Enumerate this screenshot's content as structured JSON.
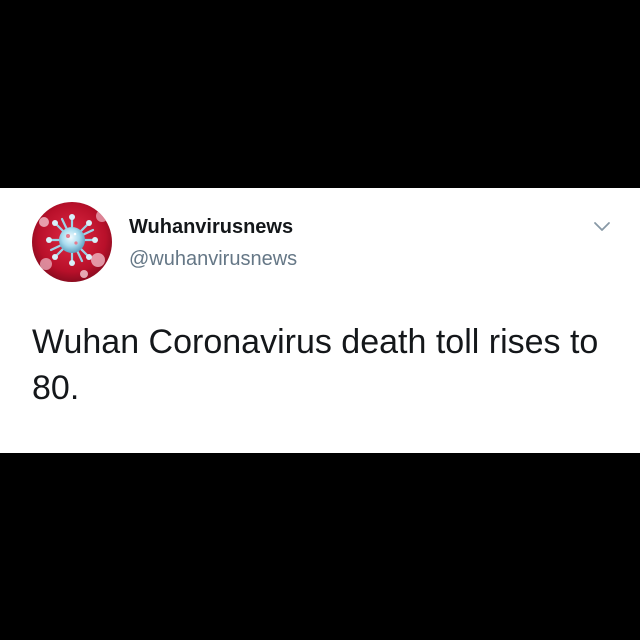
{
  "tweet": {
    "display_name": "Wuhanvirusnews",
    "handle": "@wuhanvirusnews",
    "text": "Wuhan Coronavirus death toll rises to 80.",
    "avatar_icon": "virus-icon",
    "menu_icon": "chevron-down-icon"
  },
  "colors": {
    "background": "#000000",
    "card": "#ffffff",
    "text": "#14171a",
    "secondary_text": "#657786",
    "avatar_red": "#c4122f",
    "virus_teal": "#8fd0e6"
  }
}
